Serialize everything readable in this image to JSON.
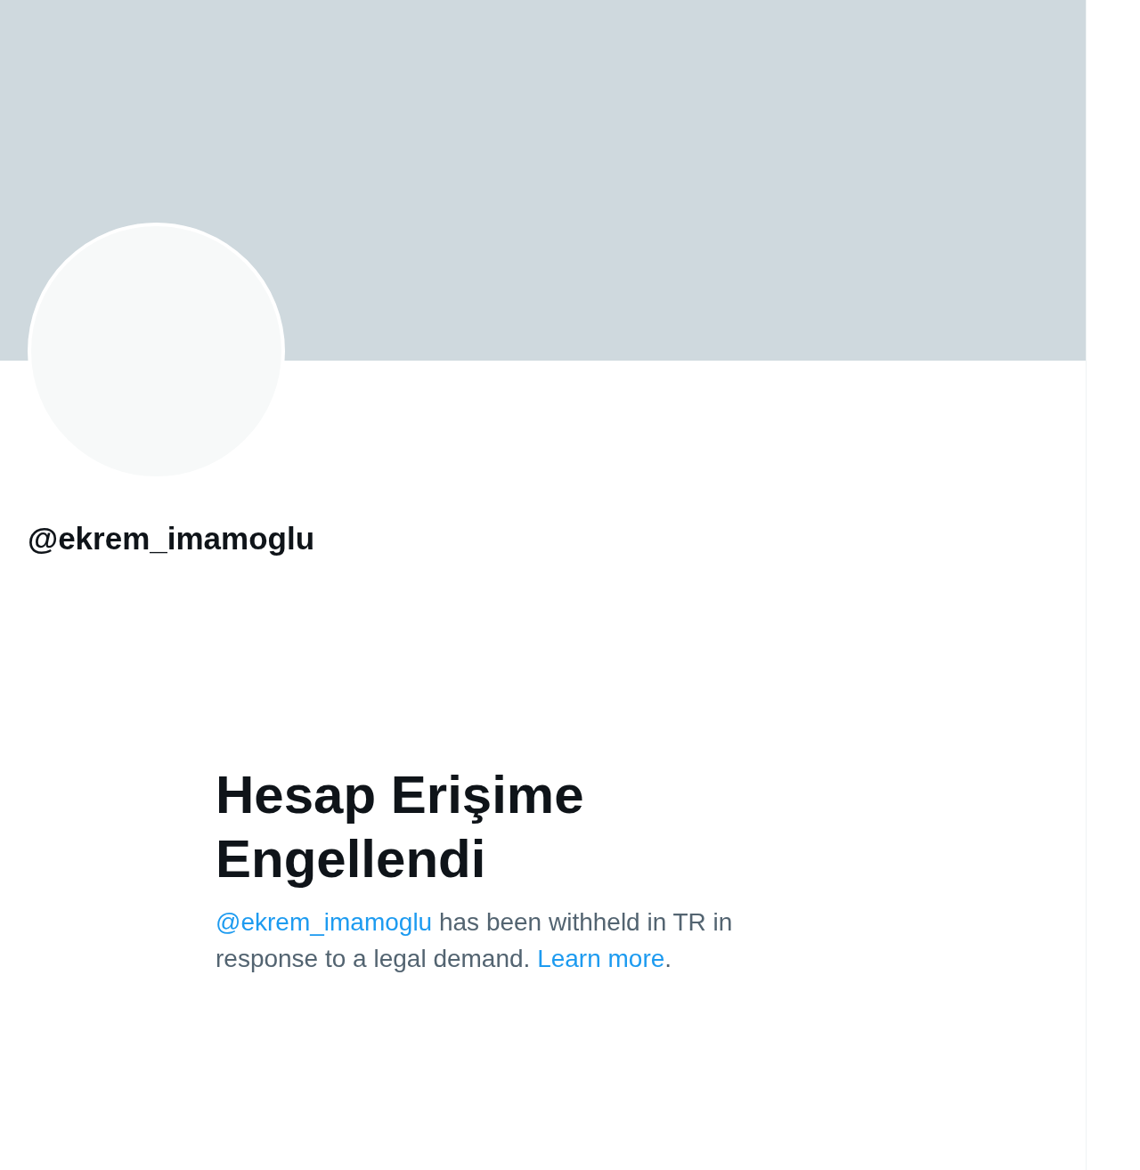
{
  "profile": {
    "handle": "@ekrem_imamoglu"
  },
  "notice": {
    "title": "Hesap Erişime Engellendi",
    "message": [
      {
        "kind": "link",
        "text": "@ekrem_imamoglu"
      },
      {
        "kind": "text",
        "text": " has been withheld in TR in response to a legal demand. "
      },
      {
        "kind": "link",
        "text": "Learn more"
      },
      {
        "kind": "text",
        "text": "."
      }
    ]
  }
}
